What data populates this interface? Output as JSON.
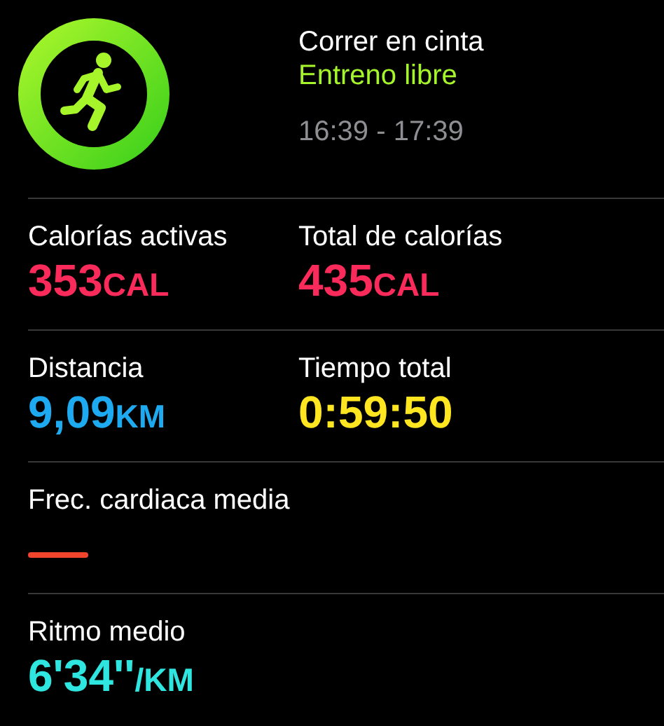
{
  "workout": {
    "title": "Correr en cinta",
    "subtitle": "Entreno libre",
    "time": "16:39 - 17:39"
  },
  "rows": [
    {
      "cells": [
        {
          "kind": "value",
          "label": "Calorías activas",
          "value": "353",
          "unit": "CAL",
          "color": "#fa2a5a"
        },
        {
          "kind": "value",
          "label": "Total de calorías",
          "value": "435",
          "unit": "CAL",
          "color": "#fa2a5a"
        }
      ]
    },
    {
      "cells": [
        {
          "kind": "value",
          "label": "Distancia",
          "value": "9,09",
          "unit": "KM",
          "color": "#1eaaf1"
        },
        {
          "kind": "value",
          "label": "Tiempo total",
          "value": "0:59:50",
          "color": "#ffe620"
        }
      ]
    },
    {
      "cells": [
        {
          "kind": "empty",
          "label": "Frec. cardiaca media",
          "color": "#f0442c"
        }
      ]
    },
    {
      "cells": [
        {
          "kind": "value",
          "label": "Ritmo medio",
          "value": "6'34''",
          "unit": "/KM",
          "color": "#2fe5e0"
        }
      ]
    }
  ]
}
